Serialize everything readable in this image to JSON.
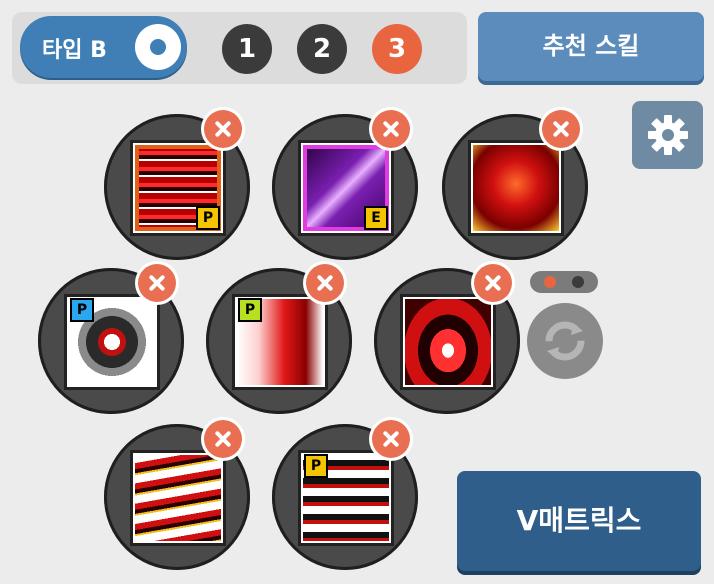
{
  "header": {
    "type_toggle_label": "타입 B",
    "pages": [
      {
        "label": "1",
        "active": false
      },
      {
        "label": "2",
        "active": false
      },
      {
        "label": "3",
        "active": true
      }
    ],
    "recommend_label": "추천 스킬"
  },
  "icons": {
    "settings": "gear-icon",
    "refresh": "refresh-icon",
    "remove": "close-icon"
  },
  "skill_slots": [
    {
      "badge": "P",
      "badge_color": "#f5c400",
      "art": "red-streak"
    },
    {
      "badge": "E",
      "badge_color": "#f5c400",
      "art": "purple-slash"
    },
    {
      "badge": "",
      "badge_color": "",
      "art": "red-dragon"
    },
    {
      "badge": "P",
      "badge_color": "#29a8f0",
      "art": "gear-machine"
    },
    {
      "badge": "P",
      "badge_color": "#b8e020",
      "art": "red-burst"
    },
    {
      "badge": "",
      "badge_color": "",
      "art": "red-shockwave"
    },
    {
      "badge": "",
      "badge_color": "",
      "art": "red-fire-dash"
    },
    {
      "badge": "P",
      "badge_color": "#f5c400",
      "art": "black-spikes"
    }
  ],
  "pager_dots": [
    {
      "active": true,
      "color": "#e9653f"
    },
    {
      "active": false,
      "color": "#3b3b3b"
    }
  ],
  "vmatrix_label": "V매트릭스",
  "colors": {
    "accent_blue": "#3f7fb6",
    "active_page": "#e9653f",
    "remove_red": "#e86f52",
    "vmatrix_blue": "#2f5e8a"
  }
}
